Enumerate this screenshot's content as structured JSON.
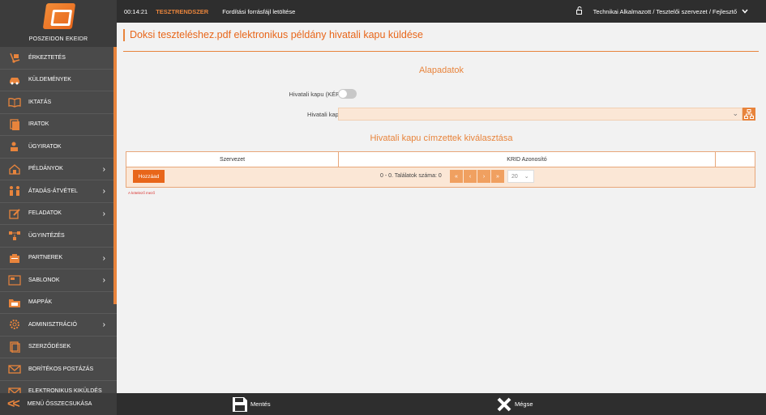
{
  "app": {
    "name": "POSZEIDON EKEIDR"
  },
  "sidebar": {
    "items": [
      {
        "label": "ÉRKEZTETÉS",
        "icon": "hand-truck-icon",
        "has_submenu": false
      },
      {
        "label": "KÜLDEMÉNYEK",
        "icon": "car-icon",
        "has_submenu": false
      },
      {
        "label": "IKTATÁS",
        "icon": "open-book-icon",
        "has_submenu": false
      },
      {
        "label": "IRATOK",
        "icon": "documents-icon",
        "has_submenu": false
      },
      {
        "label": "ÜGYIRATOK",
        "icon": "person-document-icon",
        "has_submenu": false
      },
      {
        "label": "PÉLDÁNYOK",
        "icon": "house-document-icon",
        "has_submenu": true
      },
      {
        "label": "ÁTADÁS-ÁTVÉTEL",
        "icon": "handover-icon",
        "has_submenu": true
      },
      {
        "label": "FELADATOK",
        "icon": "edit-task-icon",
        "has_submenu": true
      },
      {
        "label": "ÜGYINTÉZÉS",
        "icon": "workflow-icon",
        "has_submenu": false
      },
      {
        "label": "PARTNEREK",
        "icon": "partners-icon",
        "has_submenu": true
      },
      {
        "label": "SABLONOK",
        "icon": "template-icon",
        "has_submenu": true
      },
      {
        "label": "MAPPÁK",
        "icon": "folder-icon",
        "has_submenu": false
      },
      {
        "label": "ADMINISZTRÁCIÓ",
        "icon": "gear-icon",
        "has_submenu": true
      },
      {
        "label": "SZERZŐDÉSEK",
        "icon": "contract-icon",
        "has_submenu": false
      },
      {
        "label": "BORÍTÉKOS POSTÁZÁS",
        "icon": "envelope-icon",
        "has_submenu": false
      },
      {
        "label": "ELEKTRONIKUS KIKÜLDÉS",
        "icon": "mail-send-icon",
        "has_submenu": false
      }
    ],
    "collapse_label": "MENÜ ÖSSZECSUKÁSA"
  },
  "topbar": {
    "time": "00:14:21",
    "environment": "TESZTRENDSZER",
    "link": "Fordítási forrásfájl letöltése",
    "user": "Technikai Alkalmazott / Tesztelői szervezet / Fejlesztő"
  },
  "main": {
    "title": "Doksi teszteléshez.pdf elektronikus példány hivatali kapu küldése",
    "section1_title": "Alapadatok",
    "toggle_label": "Hivatali kapu (KÉR)",
    "toggle_on": false,
    "select_label": "Hivatali kapu",
    "select_value": "",
    "section2_title": "Hivatali kapu címzettek kiválasztása",
    "grid": {
      "columns": [
        "Szervezet",
        "KRID Azonosító",
        ""
      ],
      "add_label": "Hozzáad",
      "pager_text": "0 - 0. Találatok száma: 0",
      "page_size": "20"
    },
    "hint": "A kötelező mező"
  },
  "bottombar": {
    "save_label": "Mentés",
    "cancel_label": "Mégse"
  },
  "colors": {
    "accent": "#e8843c",
    "sidebar_bg": "#4a4a4a",
    "topbar_bg": "#2e2e2e",
    "field_bg": "#fbe7d6"
  }
}
